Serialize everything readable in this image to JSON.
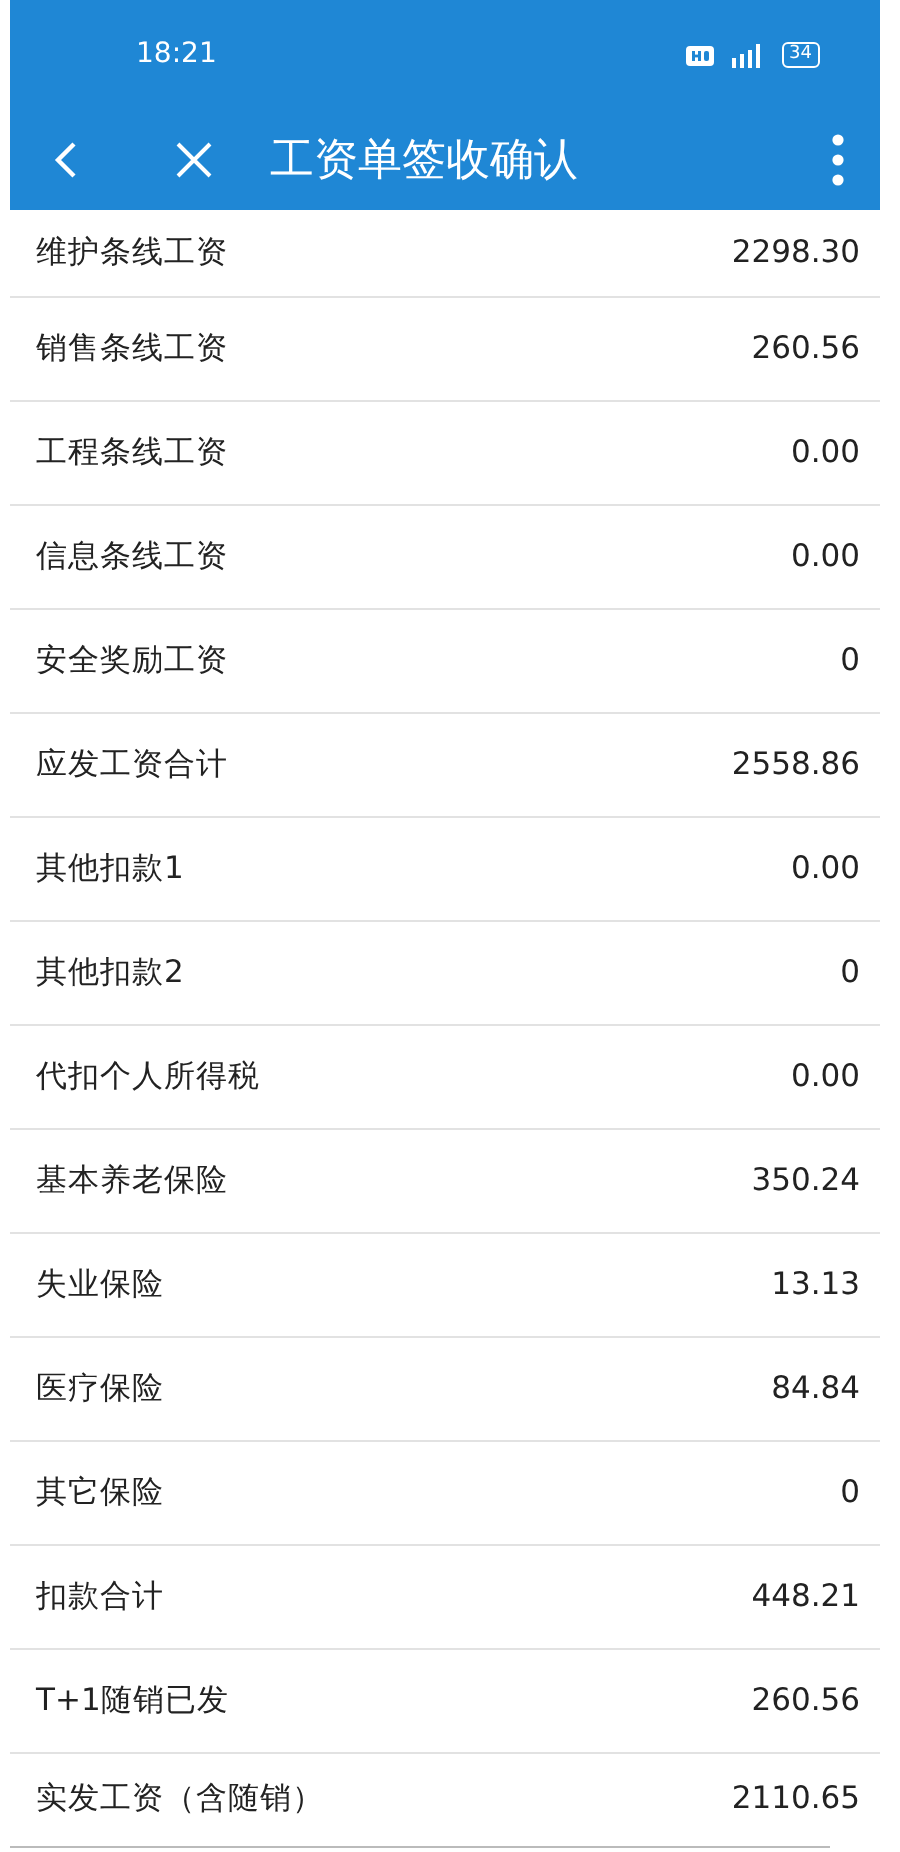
{
  "status_bar": {
    "time": "18:21",
    "battery": "34"
  },
  "toolbar": {
    "title": "工资单签收确认"
  },
  "rows": [
    {
      "label": "维护条线工资",
      "value": "2298.30"
    },
    {
      "label": "销售条线工资",
      "value": "260.56"
    },
    {
      "label": "工程条线工资",
      "value": "0.00"
    },
    {
      "label": "信息条线工资",
      "value": "0.00"
    },
    {
      "label": "安全奖励工资",
      "value": "0"
    },
    {
      "label": "应发工资合计",
      "value": "2558.86"
    },
    {
      "label": "其他扣款1",
      "value": "0.00"
    },
    {
      "label": "其他扣款2",
      "value": "0"
    },
    {
      "label": "代扣个人所得税",
      "value": "0.00"
    },
    {
      "label": "基本养老保险",
      "value": "350.24"
    },
    {
      "label": "失业保险",
      "value": "13.13"
    },
    {
      "label": "医疗保险",
      "value": "84.84"
    },
    {
      "label": "其它保险",
      "value": "0"
    },
    {
      "label": "扣款合计",
      "value": "448.21"
    },
    {
      "label": "T+1随销已发",
      "value": "260.56"
    },
    {
      "label": "实发工资（含随销）",
      "value": "2110.65"
    }
  ]
}
